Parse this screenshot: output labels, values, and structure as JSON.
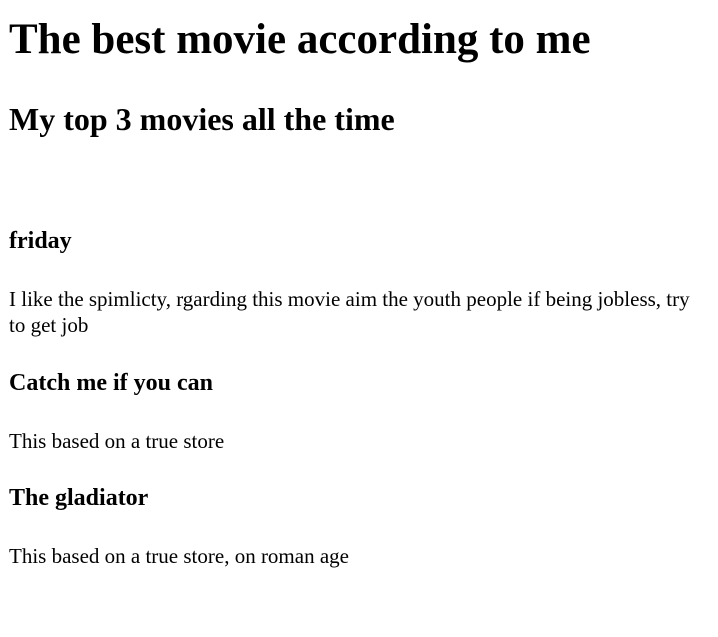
{
  "page": {
    "title": "The best movie according to me",
    "subtitle": "My top 3 movies all the time"
  },
  "movies": [
    {
      "title": "friday",
      "description": "I like the spimlicty, rgarding this movie aim the youth people if being jobless, try to get job"
    },
    {
      "title": "Catch me if you can",
      "description": "This based on a true store"
    },
    {
      "title": "The gladiator",
      "description": "This based on a true store, on roman age"
    }
  ]
}
